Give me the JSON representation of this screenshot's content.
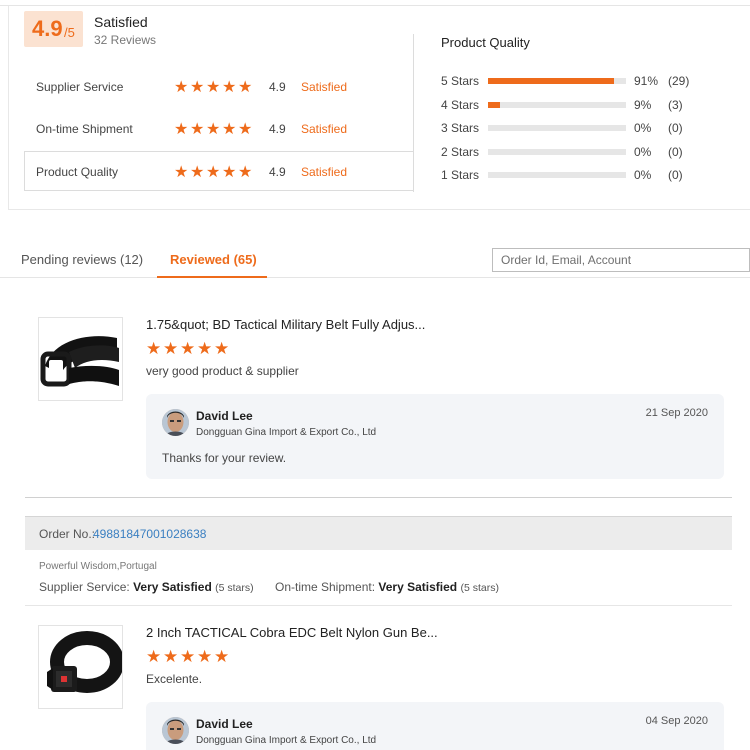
{
  "overall": {
    "score": "4.9",
    "max": "/5",
    "label": "Satisfied",
    "count": "32 Reviews"
  },
  "dsr": [
    {
      "name": "Supplier Service",
      "score": "4.9",
      "text": "Satisfied",
      "stars": 5
    },
    {
      "name": "On-time Shipment",
      "score": "4.9",
      "text": "Satisfied",
      "stars": 5
    },
    {
      "name": "Product Quality",
      "score": "4.9",
      "text": "Satisfied",
      "stars": 5
    }
  ],
  "product_quality": {
    "title": "Product Quality",
    "rows": [
      {
        "label": "5 Stars",
        "fraction": 0.91,
        "pct": "91%",
        "count": "(29)"
      },
      {
        "label": "4 Stars",
        "fraction": 0.09,
        "pct": "9%",
        "count": "(3)"
      },
      {
        "label": "3 Stars",
        "fraction": 0,
        "pct": "0%",
        "count": "(0)"
      },
      {
        "label": "2 Stars",
        "fraction": 0,
        "pct": "0%",
        "count": "(0)"
      },
      {
        "label": "1 Stars",
        "fraction": 0,
        "pct": "0%",
        "count": "(0)"
      }
    ]
  },
  "tabs": {
    "pending": "Pending reviews (12)",
    "reviewed": "Reviewed (65)"
  },
  "search": {
    "placeholder": "Order Id, Email, Account"
  },
  "colors": {
    "accent": "#ee6b1b",
    "link": "#3a7fc1"
  },
  "reviews": [
    {
      "title": "1.75&quot; BD Tactical Military Belt Fully Adjus...",
      "stars": 5,
      "comment": "very good product & supplier",
      "reply": {
        "name": "David Lee",
        "company": "Dongguan Gina Import & Export Co., Ltd",
        "date": "21 Sep 2020",
        "text": "Thanks for your review."
      }
    },
    {
      "title": "2 Inch TACTICAL Cobra EDC Belt Nylon Gun Be...",
      "stars": 5,
      "comment": "Excelente.",
      "reply": {
        "name": "David Lee",
        "company": "Dongguan Gina Import & Export Co., Ltd",
        "date": "04 Sep 2020"
      }
    }
  ],
  "order": {
    "label": "Order No.:",
    "number": "49881847001028638",
    "buyer": "Powerful Wisdom,Portugal",
    "supplier_label": "Supplier Service:",
    "supplier_value": "Very Satisfied",
    "supplier_stars": "(5 stars)",
    "shipment_label": "On-time Shipment:",
    "shipment_value": "Very Satisfied",
    "shipment_stars": "(5 stars)"
  }
}
